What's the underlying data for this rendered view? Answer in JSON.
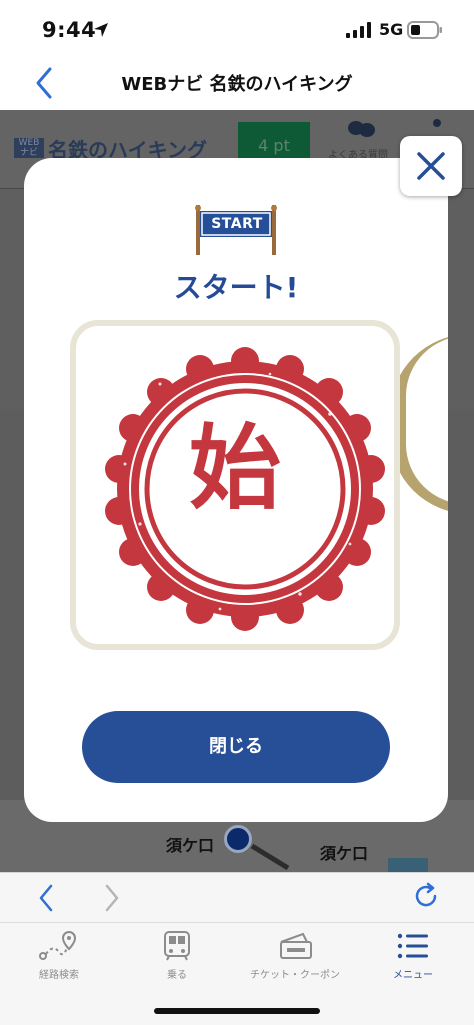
{
  "status_bar": {
    "time": "9:44",
    "network": "5G"
  },
  "nav": {
    "title": "WEBナビ 名鉄のハイキング"
  },
  "web_page": {
    "logo_box": "WEB\nナビ",
    "logo_text": "名鉄のハイキング",
    "points": "4 pt",
    "faq_label": "よくある質問",
    "map_labels": [
      "須ケ口",
      "須ケ口"
    ]
  },
  "modal": {
    "banner_text": "START",
    "title": "スタート!",
    "stamp_character": "始",
    "close_button_label": "閉じる"
  },
  "tabs": [
    {
      "label": "経路検索",
      "icon": "route-search-icon",
      "active": false
    },
    {
      "label": "乗る",
      "icon": "bus-icon",
      "active": false
    },
    {
      "label": "チケット・クーポン",
      "icon": "ticket-icon",
      "active": false
    },
    {
      "label": "メニュー",
      "icon": "menu-icon",
      "active": true
    }
  ],
  "colors": {
    "accent_blue": "#264f97",
    "title_blue": "#264b96",
    "stamp_red": "#c4373f",
    "ios_blue": "#2f6fd6"
  }
}
